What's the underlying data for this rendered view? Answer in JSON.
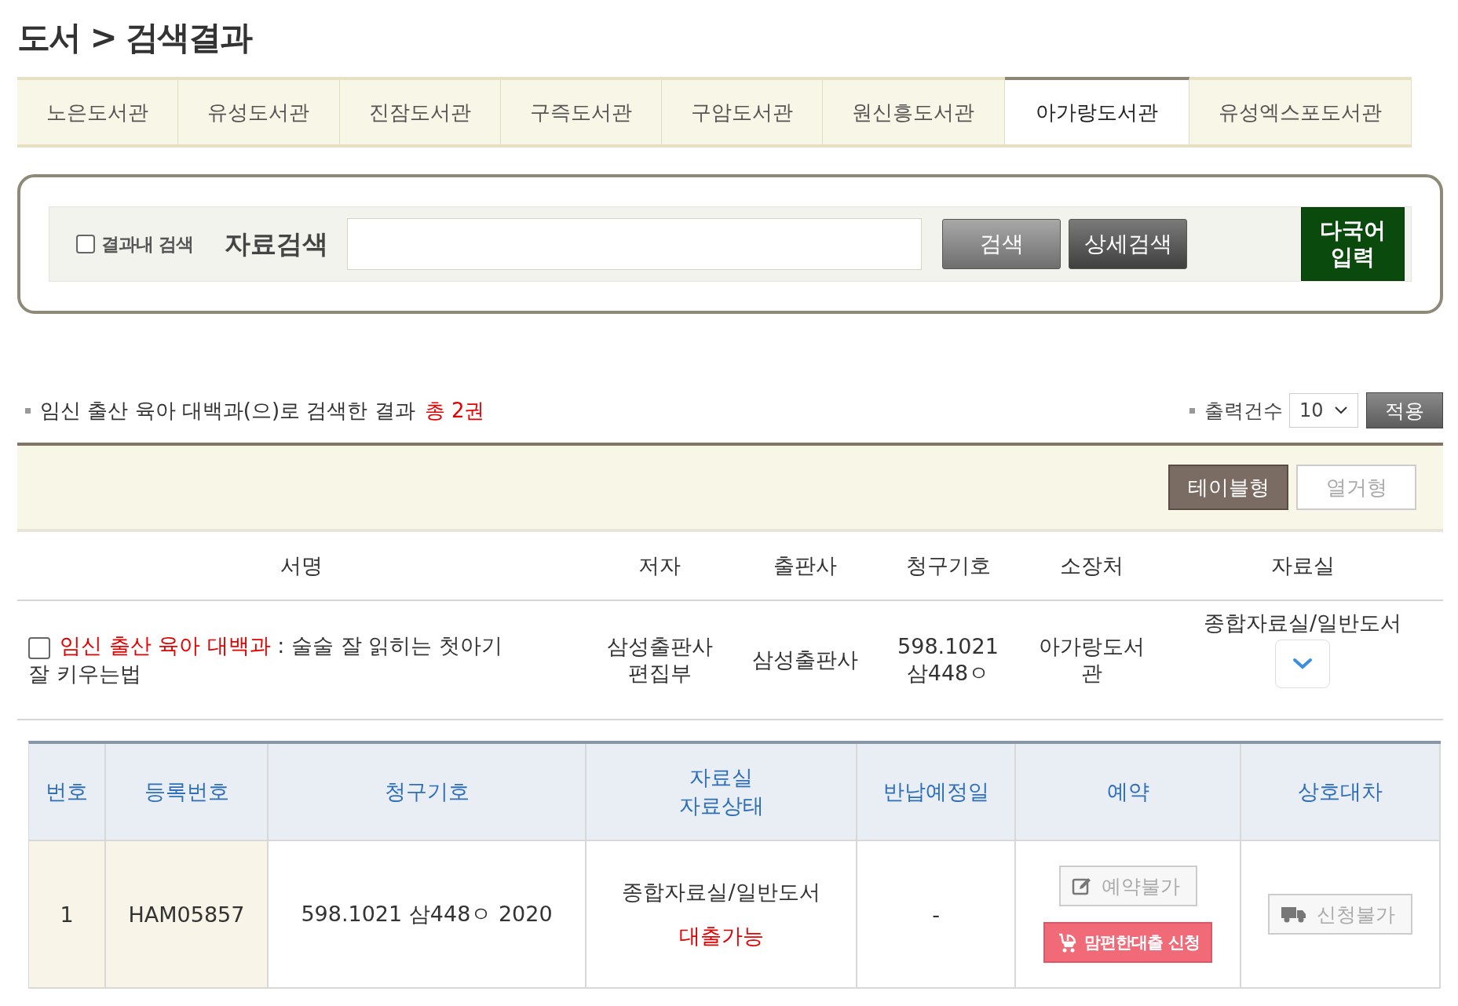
{
  "page_title": "도서 > 검색결과",
  "library_tabs": [
    {
      "label": "노은도서관",
      "selected": false
    },
    {
      "label": "유성도서관",
      "selected": false
    },
    {
      "label": "진잠도서관",
      "selected": false
    },
    {
      "label": "구즉도서관",
      "selected": false
    },
    {
      "label": "구암도서관",
      "selected": false
    },
    {
      "label": "원신흥도서관",
      "selected": false
    },
    {
      "label": "아가랑도서관",
      "selected": true
    },
    {
      "label": "유성엑스포도서관",
      "selected": false
    }
  ],
  "search": {
    "scope_checkbox": {
      "label": "결과내 검색",
      "checked": false
    },
    "label": "자료검색",
    "buttons": [
      "검색",
      "상세검색"
    ],
    "multilang_button": "다국어 입력"
  },
  "summary": {
    "text": "임신 출산 육아 대백과(으)로 검색한 결과",
    "total": "총 2권"
  },
  "page_size": {
    "label": "출력건수",
    "value": "10",
    "apply_button": "적용"
  },
  "view_modes": [
    {
      "label": "테이블형",
      "selected": true
    },
    {
      "label": "열거형",
      "selected": false
    }
  ],
  "results_table": {
    "columns": [
      "서명",
      "저자",
      "출판사",
      "청구기호",
      "소장처",
      "자료실"
    ],
    "rows": [
      {
        "checked": false,
        "title_highlight": "임신 출산 육아 대백과",
        "title_rest": " : 술술 잘 읽히는 첫아기 잘 키우는법",
        "author": "삼성출판사 편집부",
        "publisher": "삼성출판사",
        "call_number": "598.1021 삼448ㅇ",
        "location": "아가랑도서관",
        "room": "종합자료실/일반도서"
      }
    ]
  },
  "holdings_table": {
    "columns": [
      "번호",
      "등록번호",
      "청구기호",
      "자료실\n자료상태",
      "반납예정일",
      "예약",
      "상호대차"
    ],
    "rows": [
      {
        "no": "1",
        "reg_no": "HAM05857",
        "call_number": "598.1021 삼448ㅇ 2020",
        "room": "종합자료실/일반도서",
        "status": "대출가능",
        "due_date": "-",
        "reserve": {
          "label": "예약불가",
          "disabled": true
        },
        "easy_loan_button": "맘편한대출 신청",
        "interlibrary": {
          "label": "신청불가",
          "disabled": true
        }
      }
    ]
  }
}
